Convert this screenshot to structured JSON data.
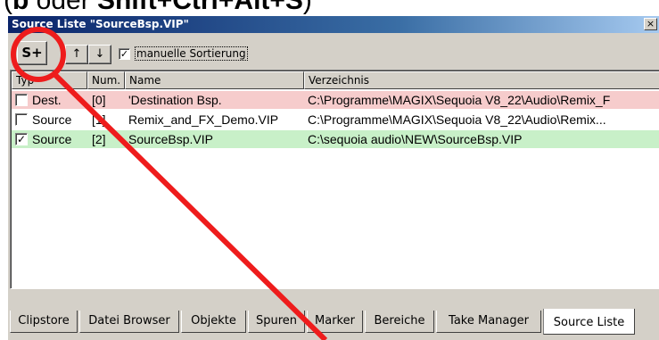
{
  "caption": {
    "text_prefix": "(",
    "bold_key": "b",
    "text_mid": " oder ",
    "shortcut": "Shift+Ctrl+Alt+S",
    "text_suffix": ")"
  },
  "window": {
    "title": "Source Liste  \"SourceBsp.VIP\"",
    "close_label": "×"
  },
  "toolbar": {
    "add_source_label": "S+",
    "move_up_label": "↑",
    "move_down_label": "↓",
    "manual_sort_checked": "✓",
    "manual_sort_label": "manuelle Sortierung"
  },
  "list": {
    "columns": [
      "Typ",
      "Num.",
      "Name",
      "Verzeichnis"
    ],
    "rows": [
      {
        "checked": "",
        "type": "Dest.",
        "num": "[0]",
        "name": "'Destination Bsp.",
        "dir": "C:\\Programme\\MAGIX\\Sequoia V8_22\\Audio\\Remix_F",
        "bg": "#f6cccc"
      },
      {
        "checked": "",
        "type": "Source",
        "num": "[1]",
        "name": "Remix_and_FX_Demo.VIP",
        "dir": "C:\\Programme\\MAGIX\\Sequoia V8_22\\Audio\\Remix...",
        "bg": "#ffffff"
      },
      {
        "checked": "✓",
        "type": "Source",
        "num": "[2]",
        "name": "SourceBsp.VIP",
        "dir": "C:\\sequoia audio\\NEW\\SourceBsp.VIP",
        "bg": "#c8f0c8"
      }
    ]
  },
  "scrollbar": {
    "left_arrow": "◀",
    "right_arrow": "▶"
  },
  "tabs": [
    {
      "label": "Clipstore",
      "active": false
    },
    {
      "label": "Datei Browser",
      "active": false
    },
    {
      "label": "Objekte",
      "active": false
    },
    {
      "label": "Spuren",
      "active": false
    },
    {
      "label": "Marker",
      "active": false
    },
    {
      "label": "Bereiche",
      "active": false
    },
    {
      "label": "Take Manager",
      "active": false
    },
    {
      "label": "Source Liste",
      "active": true
    }
  ],
  "colors": {
    "annotation": "#ee1c1c"
  }
}
